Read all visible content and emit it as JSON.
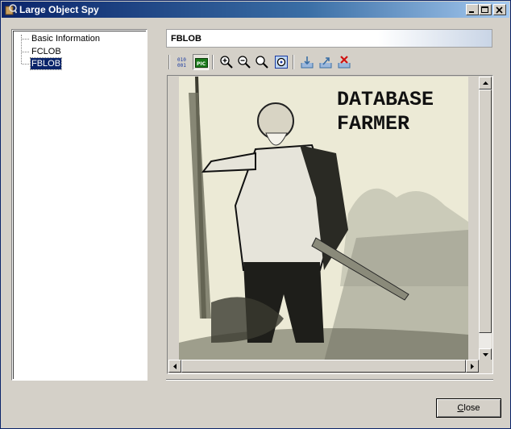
{
  "window": {
    "title": "Large Object Spy"
  },
  "tree": {
    "items": [
      {
        "label": "Basic Information",
        "selected": false
      },
      {
        "label": "FCLOB",
        "selected": false
      },
      {
        "label": "FBLOB",
        "selected": true
      }
    ]
  },
  "field": {
    "name": "FBLOB"
  },
  "toolbar": {
    "tools": [
      "binary-view-icon",
      "picture-view-icon",
      "zoom-in-icon",
      "zoom-out-icon",
      "zoom-reset-icon",
      "zoom-fit-icon",
      "import-icon",
      "export-icon",
      "delete-icon"
    ],
    "active": "picture-view-icon"
  },
  "image": {
    "caption_line1": "DATABASE",
    "caption_line2": "FARMER"
  },
  "footer": {
    "close_label": "Close",
    "close_mnemonic": "C",
    "close_rest": "lose"
  },
  "colors": {
    "titlebar_start": "#0a246a",
    "titlebar_end": "#a6caf0",
    "selection": "#0a246a"
  }
}
